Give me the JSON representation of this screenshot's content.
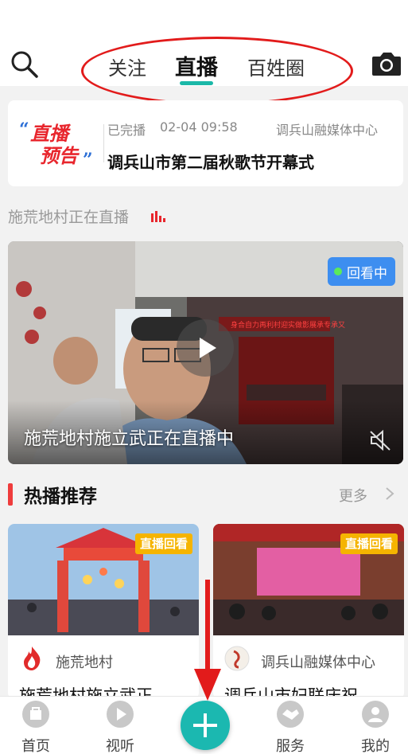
{
  "top_nav": {
    "tabs": [
      {
        "label": "关注"
      },
      {
        "label": "直播"
      },
      {
        "label": "百姓圈"
      }
    ],
    "active_tab": "直播",
    "accent_color": "#1bb8a8",
    "search_icon": "search-icon",
    "camera_icon": "camera-icon"
  },
  "live_preview": {
    "logo_text_line1": "直播",
    "logo_text_line2": "预告",
    "status": "已完播",
    "time": "02-04 09:58",
    "source": "调兵山融媒体中心",
    "title": "调兵山市第二届秋歌节开幕式"
  },
  "live_now": {
    "heading": "施荒地村正在直播",
    "badge": "回看中",
    "video_title": "施荒地村施立武正在直播中",
    "banner_text": "身合自力再利村迎实做影展承专承又"
  },
  "hot": {
    "title": "热播推荐",
    "more_label": "更多",
    "cards": [
      {
        "badge": "直播回看",
        "author": "施荒地村",
        "title": "施荒地村施立武正"
      },
      {
        "badge": "直播回看",
        "author": "调兵山融媒体中心",
        "title": "调兵山市妇联庆祝"
      }
    ]
  },
  "bottom_nav": {
    "items": [
      {
        "label": "首页",
        "icon": "home-icon"
      },
      {
        "label": "视听",
        "icon": "play-icon"
      },
      {
        "label": "",
        "icon": "plus-icon"
      },
      {
        "label": "服务",
        "icon": "handshake-icon"
      },
      {
        "label": "我的",
        "icon": "user-icon"
      }
    ]
  },
  "colors": {
    "accent": "#1bb8a8",
    "badge_blue": "#3d8ef0",
    "badge_orange": "#f5b400",
    "annotation_red": "#e21b1b"
  }
}
